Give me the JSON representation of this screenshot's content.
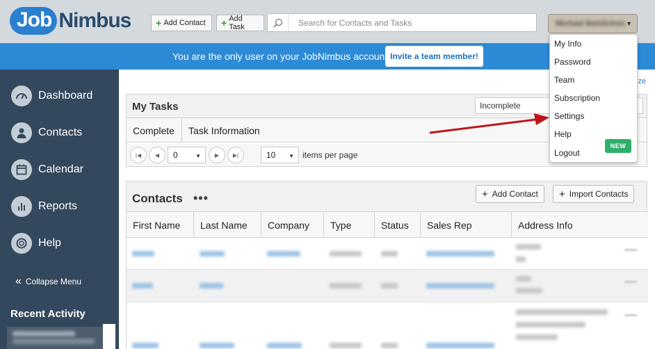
{
  "header": {
    "logo_part1": "Job",
    "logo_part2": "Nimbus",
    "add_contact_label": "Add Contact",
    "add_task_label": "Add Task",
    "search_placeholder": "Search for Contacts and Tasks",
    "user_name": "Michael Beinlicksic"
  },
  "banner": {
    "message": "You are the only user on your JobNimbus account.",
    "invite_label": "Invite a team member!"
  },
  "user_menu": {
    "items": [
      "My Info",
      "Password",
      "Team",
      "Subscription",
      "Settings",
      "Help",
      "Logout"
    ],
    "new_badge": "NEW"
  },
  "sidebar": {
    "items": [
      {
        "label": "Dashboard",
        "icon": "dashboard-icon"
      },
      {
        "label": "Contacts",
        "icon": "person-icon"
      },
      {
        "label": "Calendar",
        "icon": "calendar-icon"
      },
      {
        "label": "Reports",
        "icon": "bar-chart-icon"
      },
      {
        "label": "Help",
        "icon": "lifebuoy-icon"
      }
    ],
    "collapse_label": "Collapse Menu",
    "recent_title": "Recent Activity"
  },
  "main": {
    "customize_fragment": "ize"
  },
  "tasks": {
    "title": "My Tasks",
    "filter_value": "Incomplete",
    "columns": [
      "Complete",
      "Task Information"
    ],
    "page_value": "0",
    "per_page_value": "10",
    "per_page_label": "items per page"
  },
  "contacts": {
    "title": "Contacts",
    "more_label": "•••",
    "add_contact_label": "Add Contact",
    "import_label": "Import Contacts",
    "columns": [
      "First Name",
      "Last Name",
      "Company",
      "Type",
      "Status",
      "Sales Rep",
      "Address Info"
    ]
  },
  "colors": {
    "header_bg": "#d4d9de",
    "banner_bg": "#2c8ad6",
    "sidebar_bg": "#34485d",
    "logo_blue": "#2a7fcf",
    "new_badge": "#2fb06a",
    "annotation_arrow": "#c0131b"
  }
}
